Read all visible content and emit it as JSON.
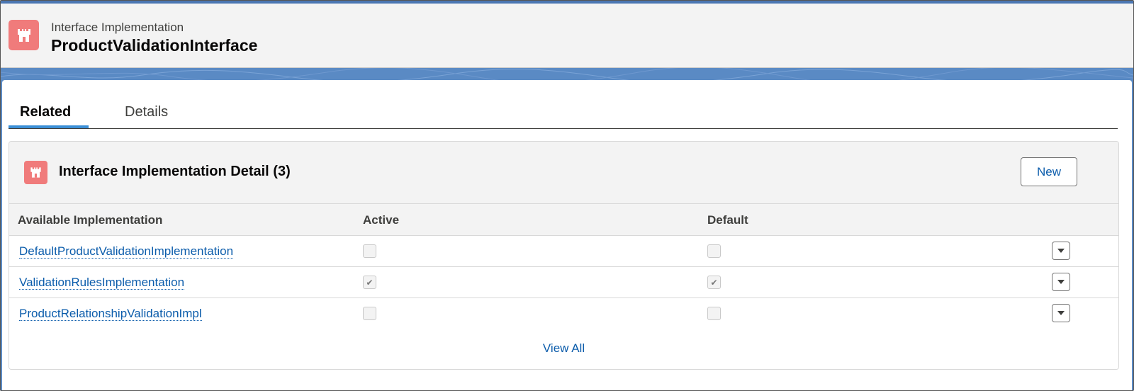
{
  "header": {
    "record_type": "Interface Implementation",
    "record_title": "ProductValidationInterface",
    "icon": "castle-icon",
    "icon_color": "#f07b7b"
  },
  "tabs": [
    {
      "label": "Related",
      "active": true
    },
    {
      "label": "Details",
      "active": false
    }
  ],
  "related_list": {
    "title": "Interface Implementation Detail (3)",
    "icon": "castle-icon",
    "new_label": "New",
    "columns": [
      "Available Implementation",
      "Active",
      "Default"
    ],
    "rows": [
      {
        "name": "DefaultProductValidationImplementation",
        "active": false,
        "default": false
      },
      {
        "name": "ValidationRulesImplementation",
        "active": true,
        "default": true
      },
      {
        "name": "ProductRelationshipValidationImpl",
        "active": false,
        "default": false
      }
    ],
    "view_all_label": "View All"
  },
  "colors": {
    "link": "#0b5cab",
    "tab_underline": "#3b8fd6",
    "banner": "#5a8ac4"
  }
}
